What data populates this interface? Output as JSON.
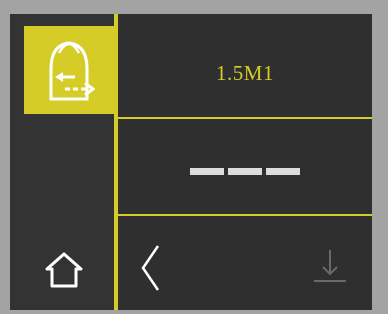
{
  "header": {
    "title": "1.5M1"
  },
  "reading": {
    "value": "---"
  },
  "icons": {
    "mode": "tape-direction-mode-icon",
    "home": "home-icon",
    "back": "chevron-left-icon",
    "download": "download-icon"
  },
  "colors": {
    "accent": "#d6cc27",
    "background": "#2f2f2f",
    "text_light": "#dcdcdc",
    "disabled": "#6a6a6a"
  }
}
